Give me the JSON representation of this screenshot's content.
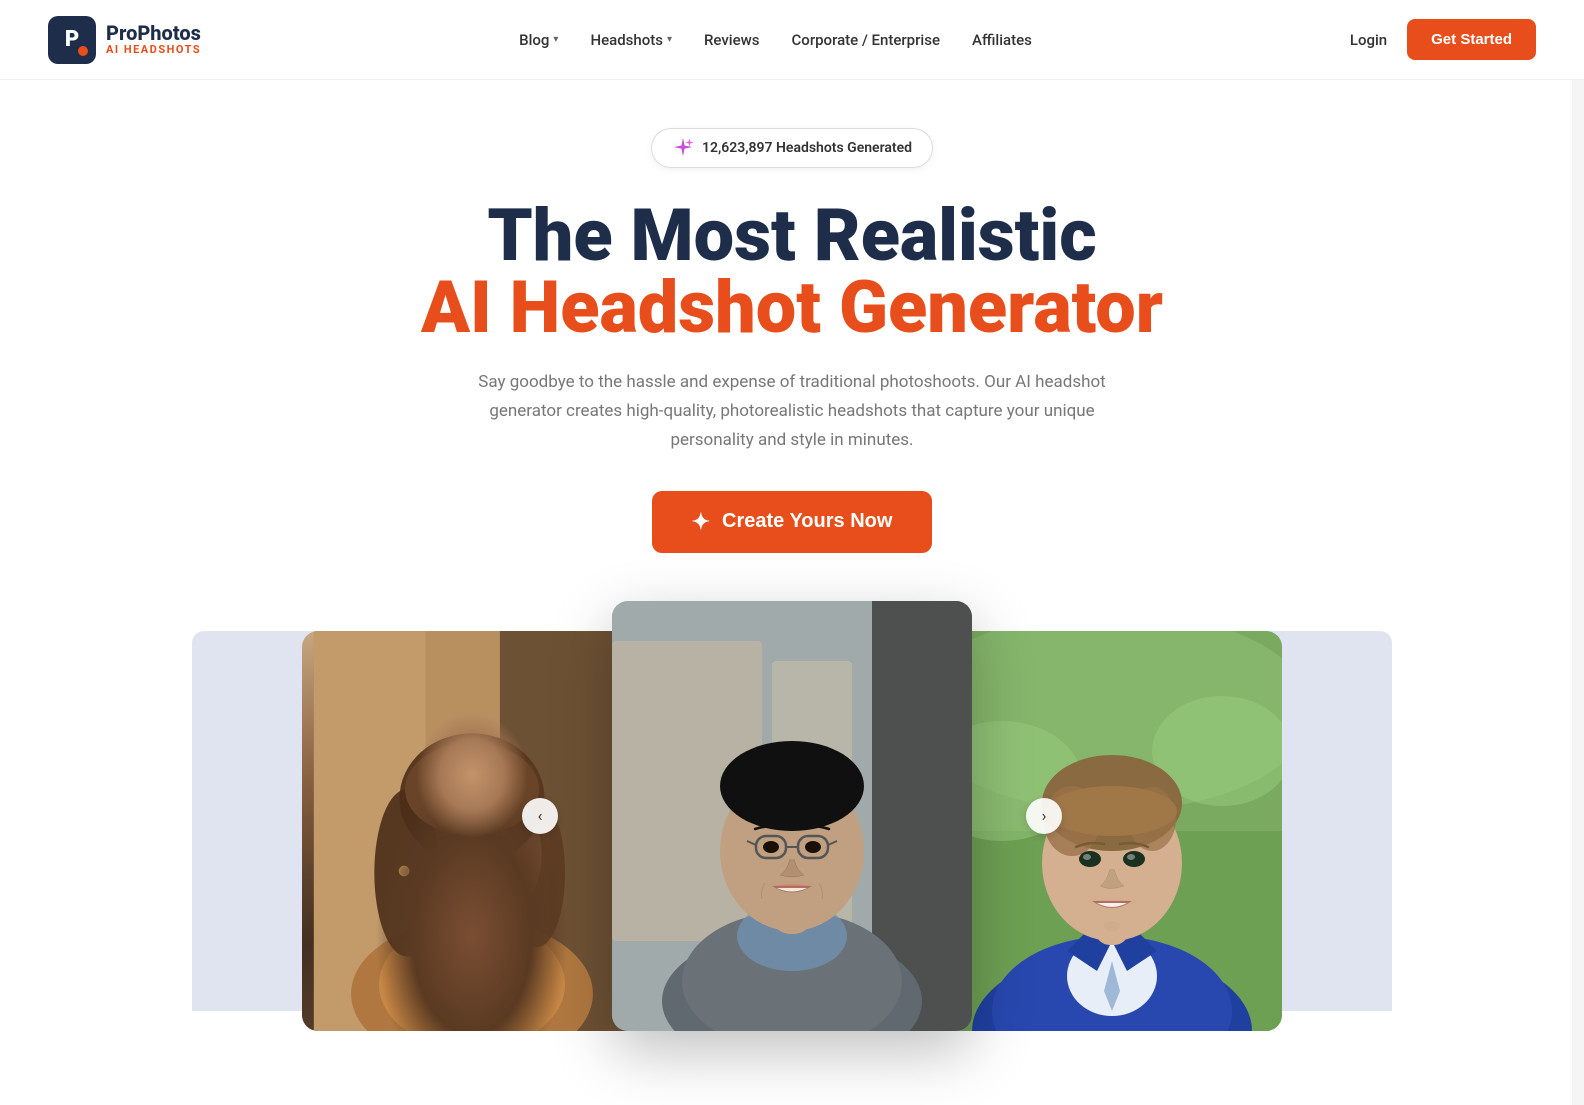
{
  "nav": {
    "logo_main": "ProPhotos",
    "logo_sub": "AI HEADSHOTS",
    "links": [
      {
        "id": "blog",
        "label": "Blog",
        "has_dropdown": true
      },
      {
        "id": "headshots",
        "label": "Headshots",
        "has_dropdown": true
      },
      {
        "id": "reviews",
        "label": "Reviews",
        "has_dropdown": false
      },
      {
        "id": "corporate",
        "label": "Corporate / Enterprise",
        "has_dropdown": false
      },
      {
        "id": "affiliates",
        "label": "Affiliates",
        "has_dropdown": false
      }
    ],
    "login_label": "Login",
    "cta_label": "Get Started"
  },
  "hero": {
    "badge_text": "12,623,897 Headshots Generated",
    "headline_line1": "The Most Realistic",
    "headline_line2": "AI Headshot Generator",
    "subtitle": "Say goodbye to the hassle and expense of traditional photoshoots. Our AI headshot generator creates high-quality, photorealistic headshots that capture your unique personality and style in minutes.",
    "cta_label": "Create Yours Now"
  },
  "gallery": {
    "left_arrow": "‹",
    "right_arrow": "›",
    "photos": [
      {
        "id": "photo-woman",
        "alt": "Woman headshot"
      },
      {
        "id": "photo-man-asian",
        "alt": "Asian man headshot"
      },
      {
        "id": "photo-man-blond",
        "alt": "Blond man headshot"
      }
    ]
  },
  "colors": {
    "brand_dark": "#1e2d4a",
    "brand_orange": "#e84e1b",
    "text_muted": "#777777"
  }
}
